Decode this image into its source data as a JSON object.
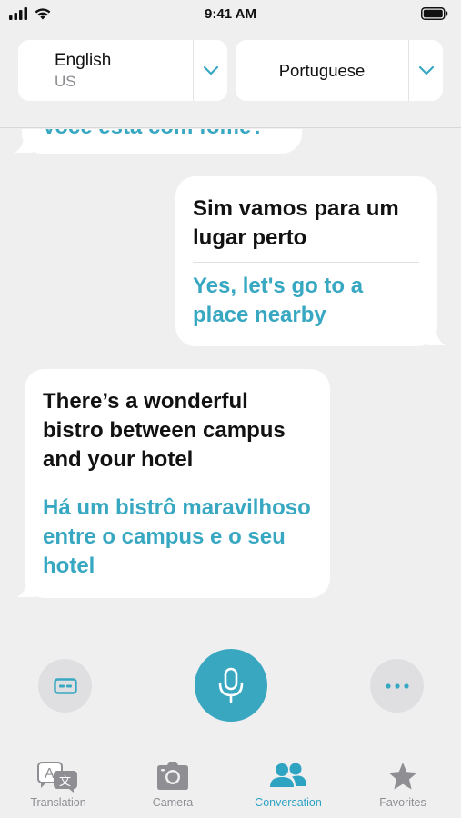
{
  "status": {
    "time": "9:41 AM"
  },
  "languages": {
    "source": {
      "name": "English",
      "region": "US"
    },
    "target": {
      "name": "Portuguese"
    }
  },
  "conversation": {
    "partial_top": "Você está com fome?",
    "messages": [
      {
        "side": "right",
        "original": "Sim vamos para um lugar perto",
        "translation": "Yes, let's go to a place nearby"
      },
      {
        "side": "left",
        "original": "There’s a wonderful bistro between campus and your hotel",
        "translation": "Há um bistrô maravilhoso entre o campus e o seu hotel"
      }
    ]
  },
  "controls": {
    "left_icon": "subtitles-icon",
    "center_icon": "microphone-icon",
    "right_icon": "more-icon"
  },
  "tabs": [
    {
      "label": "Translation",
      "icon": "translation-icon",
      "active": false
    },
    {
      "label": "Camera",
      "icon": "camera-icon",
      "active": false
    },
    {
      "label": "Conversation",
      "icon": "people-icon",
      "active": true
    },
    {
      "label": "Favorites",
      "icon": "star-icon",
      "active": false
    }
  ],
  "colors": {
    "accent": "#38a8c2",
    "background": "#efeff0",
    "bubble": "#ffffff",
    "inactive": "#8e8e93"
  }
}
